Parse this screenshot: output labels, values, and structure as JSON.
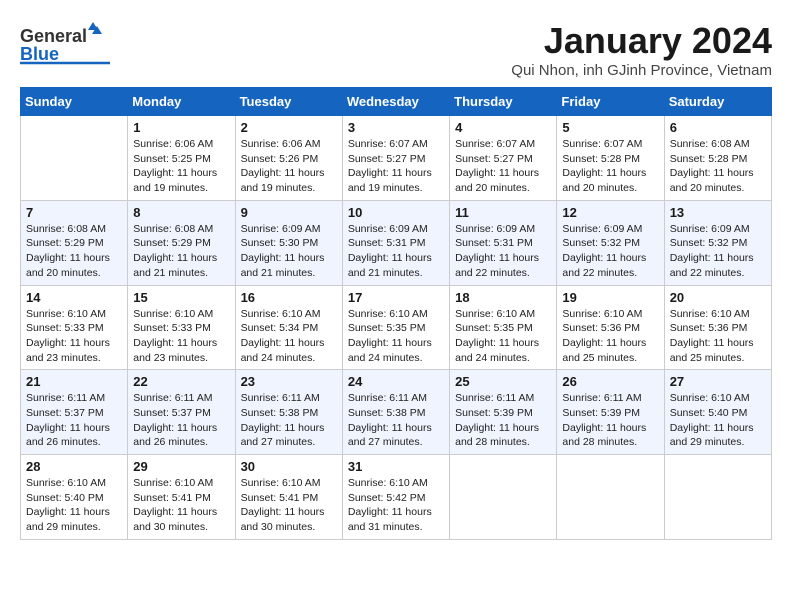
{
  "header": {
    "logo_general": "General",
    "logo_blue": "Blue",
    "title": "January 2024",
    "subtitle": "Qui Nhon, inh GJinh Province, Vietnam"
  },
  "columns": [
    "Sunday",
    "Monday",
    "Tuesday",
    "Wednesday",
    "Thursday",
    "Friday",
    "Saturday"
  ],
  "weeks": [
    [
      {
        "day": "",
        "info": ""
      },
      {
        "day": "1",
        "info": "Sunrise: 6:06 AM\nSunset: 5:25 PM\nDaylight: 11 hours\nand 19 minutes."
      },
      {
        "day": "2",
        "info": "Sunrise: 6:06 AM\nSunset: 5:26 PM\nDaylight: 11 hours\nand 19 minutes."
      },
      {
        "day": "3",
        "info": "Sunrise: 6:07 AM\nSunset: 5:27 PM\nDaylight: 11 hours\nand 19 minutes."
      },
      {
        "day": "4",
        "info": "Sunrise: 6:07 AM\nSunset: 5:27 PM\nDaylight: 11 hours\nand 20 minutes."
      },
      {
        "day": "5",
        "info": "Sunrise: 6:07 AM\nSunset: 5:28 PM\nDaylight: 11 hours\nand 20 minutes."
      },
      {
        "day": "6",
        "info": "Sunrise: 6:08 AM\nSunset: 5:28 PM\nDaylight: 11 hours\nand 20 minutes."
      }
    ],
    [
      {
        "day": "7",
        "info": "Sunrise: 6:08 AM\nSunset: 5:29 PM\nDaylight: 11 hours\nand 20 minutes."
      },
      {
        "day": "8",
        "info": "Sunrise: 6:08 AM\nSunset: 5:29 PM\nDaylight: 11 hours\nand 21 minutes."
      },
      {
        "day": "9",
        "info": "Sunrise: 6:09 AM\nSunset: 5:30 PM\nDaylight: 11 hours\nand 21 minutes."
      },
      {
        "day": "10",
        "info": "Sunrise: 6:09 AM\nSunset: 5:31 PM\nDaylight: 11 hours\nand 21 minutes."
      },
      {
        "day": "11",
        "info": "Sunrise: 6:09 AM\nSunset: 5:31 PM\nDaylight: 11 hours\nand 22 minutes."
      },
      {
        "day": "12",
        "info": "Sunrise: 6:09 AM\nSunset: 5:32 PM\nDaylight: 11 hours\nand 22 minutes."
      },
      {
        "day": "13",
        "info": "Sunrise: 6:09 AM\nSunset: 5:32 PM\nDaylight: 11 hours\nand 22 minutes."
      }
    ],
    [
      {
        "day": "14",
        "info": "Sunrise: 6:10 AM\nSunset: 5:33 PM\nDaylight: 11 hours\nand 23 minutes."
      },
      {
        "day": "15",
        "info": "Sunrise: 6:10 AM\nSunset: 5:33 PM\nDaylight: 11 hours\nand 23 minutes."
      },
      {
        "day": "16",
        "info": "Sunrise: 6:10 AM\nSunset: 5:34 PM\nDaylight: 11 hours\nand 24 minutes."
      },
      {
        "day": "17",
        "info": "Sunrise: 6:10 AM\nSunset: 5:35 PM\nDaylight: 11 hours\nand 24 minutes."
      },
      {
        "day": "18",
        "info": "Sunrise: 6:10 AM\nSunset: 5:35 PM\nDaylight: 11 hours\nand 24 minutes."
      },
      {
        "day": "19",
        "info": "Sunrise: 6:10 AM\nSunset: 5:36 PM\nDaylight: 11 hours\nand 25 minutes."
      },
      {
        "day": "20",
        "info": "Sunrise: 6:10 AM\nSunset: 5:36 PM\nDaylight: 11 hours\nand 25 minutes."
      }
    ],
    [
      {
        "day": "21",
        "info": "Sunrise: 6:11 AM\nSunset: 5:37 PM\nDaylight: 11 hours\nand 26 minutes."
      },
      {
        "day": "22",
        "info": "Sunrise: 6:11 AM\nSunset: 5:37 PM\nDaylight: 11 hours\nand 26 minutes."
      },
      {
        "day": "23",
        "info": "Sunrise: 6:11 AM\nSunset: 5:38 PM\nDaylight: 11 hours\nand 27 minutes."
      },
      {
        "day": "24",
        "info": "Sunrise: 6:11 AM\nSunset: 5:38 PM\nDaylight: 11 hours\nand 27 minutes."
      },
      {
        "day": "25",
        "info": "Sunrise: 6:11 AM\nSunset: 5:39 PM\nDaylight: 11 hours\nand 28 minutes."
      },
      {
        "day": "26",
        "info": "Sunrise: 6:11 AM\nSunset: 5:39 PM\nDaylight: 11 hours\nand 28 minutes."
      },
      {
        "day": "27",
        "info": "Sunrise: 6:10 AM\nSunset: 5:40 PM\nDaylight: 11 hours\nand 29 minutes."
      }
    ],
    [
      {
        "day": "28",
        "info": "Sunrise: 6:10 AM\nSunset: 5:40 PM\nDaylight: 11 hours\nand 29 minutes."
      },
      {
        "day": "29",
        "info": "Sunrise: 6:10 AM\nSunset: 5:41 PM\nDaylight: 11 hours\nand 30 minutes."
      },
      {
        "day": "30",
        "info": "Sunrise: 6:10 AM\nSunset: 5:41 PM\nDaylight: 11 hours\nand 30 minutes."
      },
      {
        "day": "31",
        "info": "Sunrise: 6:10 AM\nSunset: 5:42 PM\nDaylight: 11 hours\nand 31 minutes."
      },
      {
        "day": "",
        "info": ""
      },
      {
        "day": "",
        "info": ""
      },
      {
        "day": "",
        "info": ""
      }
    ]
  ]
}
